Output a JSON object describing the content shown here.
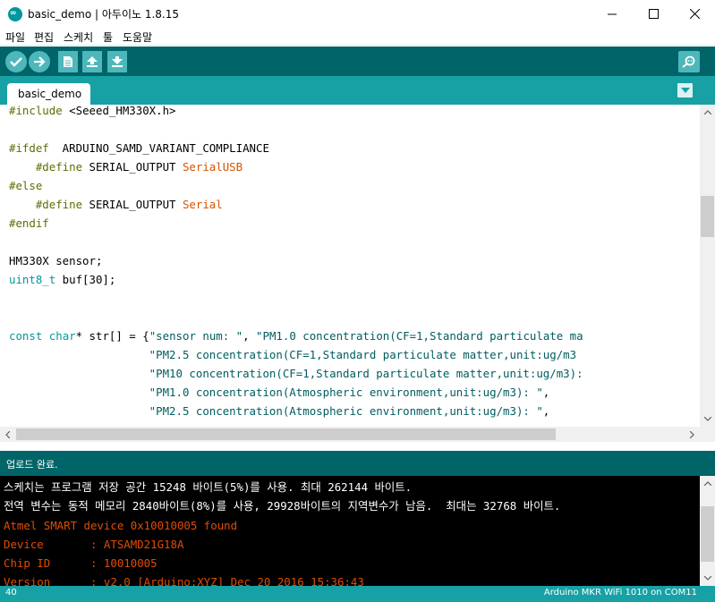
{
  "window": {
    "title": "basic_demo | 아두이노 1.8.15",
    "icon": "arduino-icon",
    "controls": [
      "minimize-icon",
      "maximize-icon",
      "close-icon"
    ]
  },
  "menu": {
    "items": [
      "파일",
      "편집",
      "스케치",
      "툴",
      "도움말"
    ]
  },
  "toolbar": {
    "buttons": [
      "verify-icon",
      "upload-icon",
      "new-icon",
      "open-icon",
      "save-icon"
    ],
    "serial_monitor": "serial-monitor-icon"
  },
  "tabs": {
    "active": "basic_demo"
  },
  "editor": {
    "lines": [
      "#include <Seeed_HM330X.h>",
      "",
      "#ifdef  ARDUINO_SAMD_VARIANT_COMPLIANCE",
      "    #define SERIAL_OUTPUT SerialUSB",
      "#else",
      "    #define SERIAL_OUTPUT Serial",
      "#endif",
      "",
      "HM330X sensor;",
      "uint8_t buf[30];",
      "",
      "",
      "const char* str[] = {\"sensor num: \", \"PM1.0 concentration(CF=1,Standard particulate ma",
      "                     \"PM2.5 concentration(CF=1,Standard particulate matter,unit:ug/m3",
      "                     \"PM10 concentration(CF=1,Standard particulate matter,unit:ug/m3):",
      "                     \"PM1.0 concentration(Atmospheric environment,unit:ug/m3): \",",
      "                     \"PM2.5 concentration(Atmospheric environment,unit:ug/m3): \","
    ]
  },
  "status": {
    "message": "업로드 완료."
  },
  "console": {
    "lines": [
      {
        "text": "스케치는 프로그램 저장 공간 15248 바이트(5%)를 사용. 최대 262144 바이트.",
        "color": "white"
      },
      {
        "text": "전역 변수는 동적 메모리 2840바이트(8%)를 사용, 29928바이트의 지역변수가 남음.  최대는 32768 바이트.",
        "color": "white"
      },
      {
        "text": "Atmel SMART device 0x10010005 found",
        "color": "orange"
      },
      {
        "text": "Device       : ATSAMD21G18A",
        "color": "orange"
      },
      {
        "text": "Chip ID      : 10010005",
        "color": "orange"
      },
      {
        "text": "Version      : v2.0 [Arduino:XYZ] Dec 20 2016 15:36:43",
        "color": "orange"
      }
    ]
  },
  "footer": {
    "line": "40",
    "board": "Arduino MKR WiFi 1010 on COM11"
  },
  "colors": {
    "toolbar": "#006468",
    "tabbar": "#17a1a5",
    "button": "#4db7bb",
    "console_orange": "#e34c00"
  }
}
